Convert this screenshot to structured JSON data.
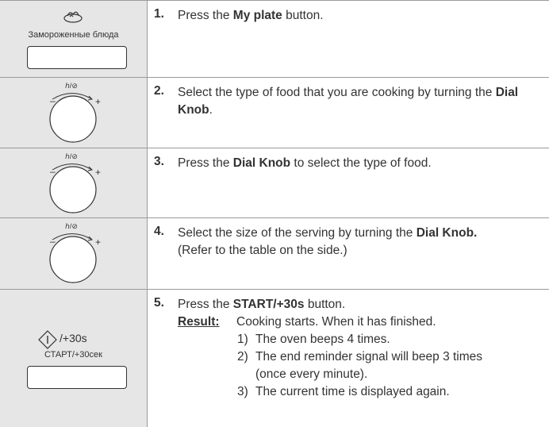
{
  "steps": [
    {
      "num": "1.",
      "pre": "Press the ",
      "bold": "My plate",
      "post": " button.",
      "panel": {
        "label": "Замороженные блюда",
        "icon": "frozen-food-icon"
      }
    },
    {
      "num": "2.",
      "pre": "Select the type of food that you are cooking by turning the ",
      "bold": "Dial Knob",
      "post": ".",
      "panel": {
        "icon": "dial-knob-icon",
        "top_symbol": "ℎ/⊘",
        "minus": "–",
        "plus": "+"
      }
    },
    {
      "num": "3.",
      "pre": "Press the ",
      "bold": "Dial Knob",
      "post": " to select the type of food.",
      "panel": {
        "icon": "dial-knob-icon",
        "top_symbol": "ℎ/⊘",
        "minus": "–",
        "plus": "+"
      }
    },
    {
      "num": "4.",
      "pre": "Select the size of the serving by turning the ",
      "bold": "Dial Knob.",
      "post": "",
      "line2": "(Refer to the table on the side.)",
      "panel": {
        "icon": "dial-knob-icon",
        "top_symbol": "ℎ/⊘",
        "minus": "–",
        "plus": "+"
      }
    },
    {
      "num": "5.",
      "pre": "Press the ",
      "bold": "START/+30s",
      "post": " button.",
      "result_label": "Result:",
      "result_text": "Cooking starts. When it has finished.",
      "items": [
        {
          "n": "1)",
          "t": "The oven beeps 4 times."
        },
        {
          "n": "2)",
          "t": "The end reminder signal will beep 3 times"
        },
        {
          "n": "",
          "t": "(once every minute)."
        },
        {
          "n": "3)",
          "t": "The current time is displayed again."
        }
      ],
      "panel": {
        "icon": "start-icon",
        "label1": "/+30s",
        "label2": "СТАРТ/+30сек"
      }
    }
  ]
}
